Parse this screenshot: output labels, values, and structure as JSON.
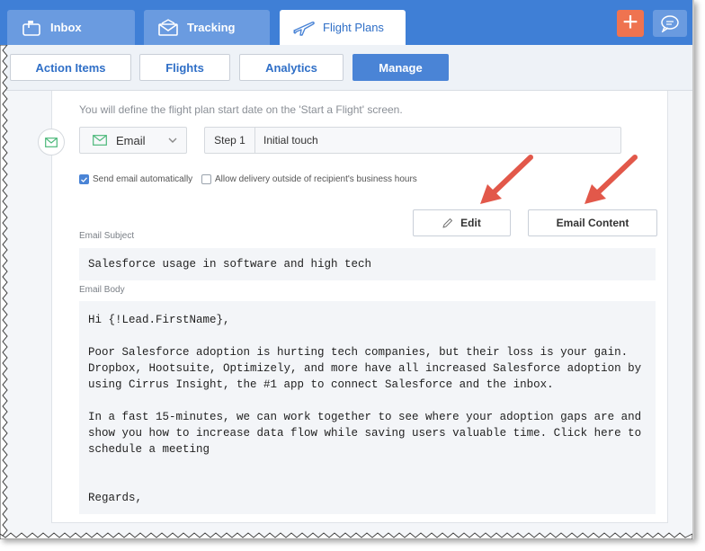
{
  "top_tabs": [
    {
      "label": "Inbox",
      "icon": "mailbox-icon"
    },
    {
      "label": "Tracking",
      "icon": "envelope-icon"
    },
    {
      "label": "Flight Plans",
      "icon": "airplane-icon"
    }
  ],
  "top_actions": {
    "add_icon": "plus-icon",
    "chat_icon": "chat-bubble-icon"
  },
  "sub_tabs": [
    "Action Items",
    "Flights",
    "Analytics",
    "Manage"
  ],
  "active_sub_tab": "Manage",
  "note": "You will define the flight plan start date on the 'Start a Flight' screen.",
  "step": {
    "type": "Email",
    "label": "Step 1",
    "name": "Initial touch"
  },
  "options": {
    "send_auto": {
      "label": "Send email automatically",
      "checked": true
    },
    "allow_delivery": {
      "label": "Allow delivery outside of recipient's business hours",
      "checked": false
    }
  },
  "buttons": {
    "edit": "Edit",
    "email_content": "Email Content"
  },
  "email": {
    "subject_label": "Email Subject",
    "subject": "Salesforce usage in software and high tech",
    "body_label": "Email Body",
    "body": {
      "greeting": "Hi {!Lead.FirstName},",
      "p1_l1": "Poor Salesforce adoption is hurting tech companies, but their loss is your gain.",
      "p1_l2": "Dropbox, Hootsuite, Optimizely, and more have all increased Salesforce adoption by",
      "p1_l3": "using Cirrus Insight, the #1 app to connect Salesforce and the inbox.",
      "p2_l1": "In a fast 15-minutes, we can work together to see where your adoption gaps are and",
      "p2_l2": "show you how to increase data flow while saving users valuable time. Click here to",
      "p2_l3": "schedule a meeting",
      "closing": "Regards,"
    }
  },
  "colors": {
    "brand_blue": "#3f7fd6",
    "accent_orange": "#ef7350",
    "arrow_red": "#e2584a"
  }
}
